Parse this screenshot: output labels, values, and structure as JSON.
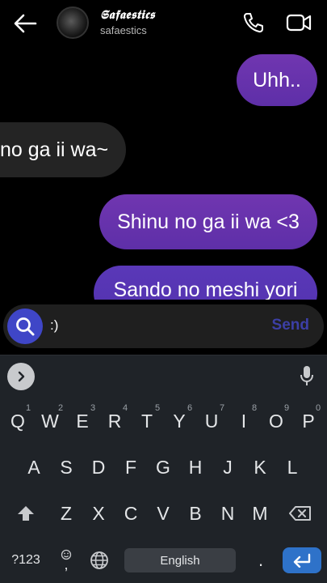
{
  "header": {
    "name": "𝕾𝖆𝖋𝖆𝖊𝖘𝖙𝖎𝖈𝖘",
    "handle": "safaestics",
    "icons": [
      "back-arrow-icon",
      "avatar",
      "phone-icon",
      "video-camera-icon"
    ]
  },
  "messages": [
    {
      "direction": "outgoing",
      "text": "Uhh.."
    },
    {
      "direction": "incoming",
      "text": "no ga ii wa~"
    },
    {
      "direction": "outgoing",
      "text": "Shinu no ga ii wa <3"
    },
    {
      "direction": "outgoing",
      "text": "Sando no meshi yori"
    }
  ],
  "composer": {
    "text": ":)",
    "send_label": "Send",
    "search_icon": "search-icon"
  },
  "keyboard": {
    "row1": [
      {
        "key": "Q",
        "hint": "1"
      },
      {
        "key": "W",
        "hint": "2"
      },
      {
        "key": "E",
        "hint": "3"
      },
      {
        "key": "R",
        "hint": "4"
      },
      {
        "key": "T",
        "hint": "5"
      },
      {
        "key": "Y",
        "hint": "6"
      },
      {
        "key": "U",
        "hint": "7"
      },
      {
        "key": "I",
        "hint": "8"
      },
      {
        "key": "O",
        "hint": "9"
      },
      {
        "key": "P",
        "hint": "0"
      }
    ],
    "row2": [
      "A",
      "S",
      "D",
      "F",
      "G",
      "H",
      "J",
      "K",
      "L"
    ],
    "row3": [
      "Z",
      "X",
      "C",
      "V",
      "B",
      "N",
      "M"
    ],
    "symbols_label": "?123",
    "emoji_label": ",",
    "comma_label": ",",
    "space_label": "English",
    "period_label": "."
  },
  "colors": {
    "outgoing_bubble": "#6232ab",
    "incoming_bubble": "#242424",
    "send_text": "#3c3fa6",
    "search_button": "#3f46c7",
    "enter_key": "#2e72c9",
    "keyboard_bg": "#1f2328"
  }
}
